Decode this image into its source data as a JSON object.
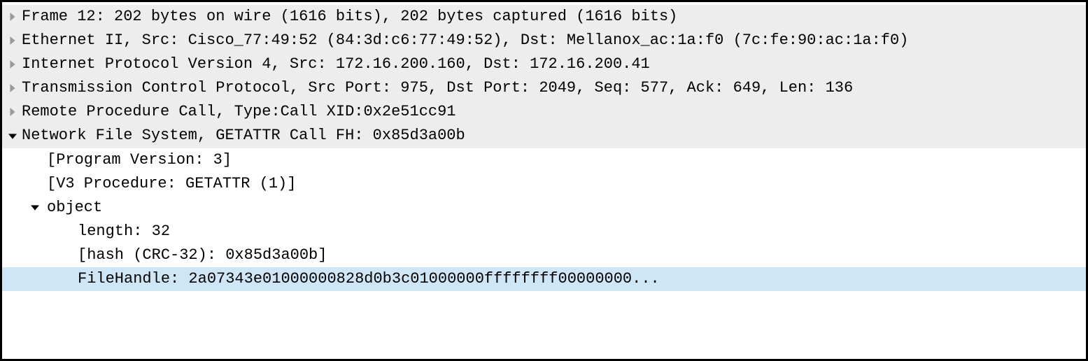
{
  "rows": {
    "frame": "Frame 12: 202 bytes on wire (1616 bits), 202 bytes captured (1616 bits)",
    "ethernet": "Ethernet II, Src: Cisco_77:49:52 (84:3d:c6:77:49:52), Dst: Mellanox_ac:1a:f0 (7c:fe:90:ac:1a:f0)",
    "ip": "Internet Protocol Version 4, Src: 172.16.200.160, Dst: 172.16.200.41",
    "tcp": "Transmission Control Protocol, Src Port: 975, Dst Port: 2049, Seq: 577, Ack: 649, Len: 136",
    "rpc": "Remote Procedure Call, Type:Call XID:0x2e51cc91",
    "nfs": "Network File System, GETATTR Call FH: 0x85d3a00b",
    "program_version": "[Program Version: 3]",
    "v3_procedure": "[V3 Procedure: GETATTR (1)]",
    "object": "object",
    "length": "length: 32",
    "hash": "[hash (CRC-32): 0x85d3a00b]",
    "filehandle": "FileHandle: 2a07343e01000000828d0b3c01000000ffffffff00000000..."
  }
}
